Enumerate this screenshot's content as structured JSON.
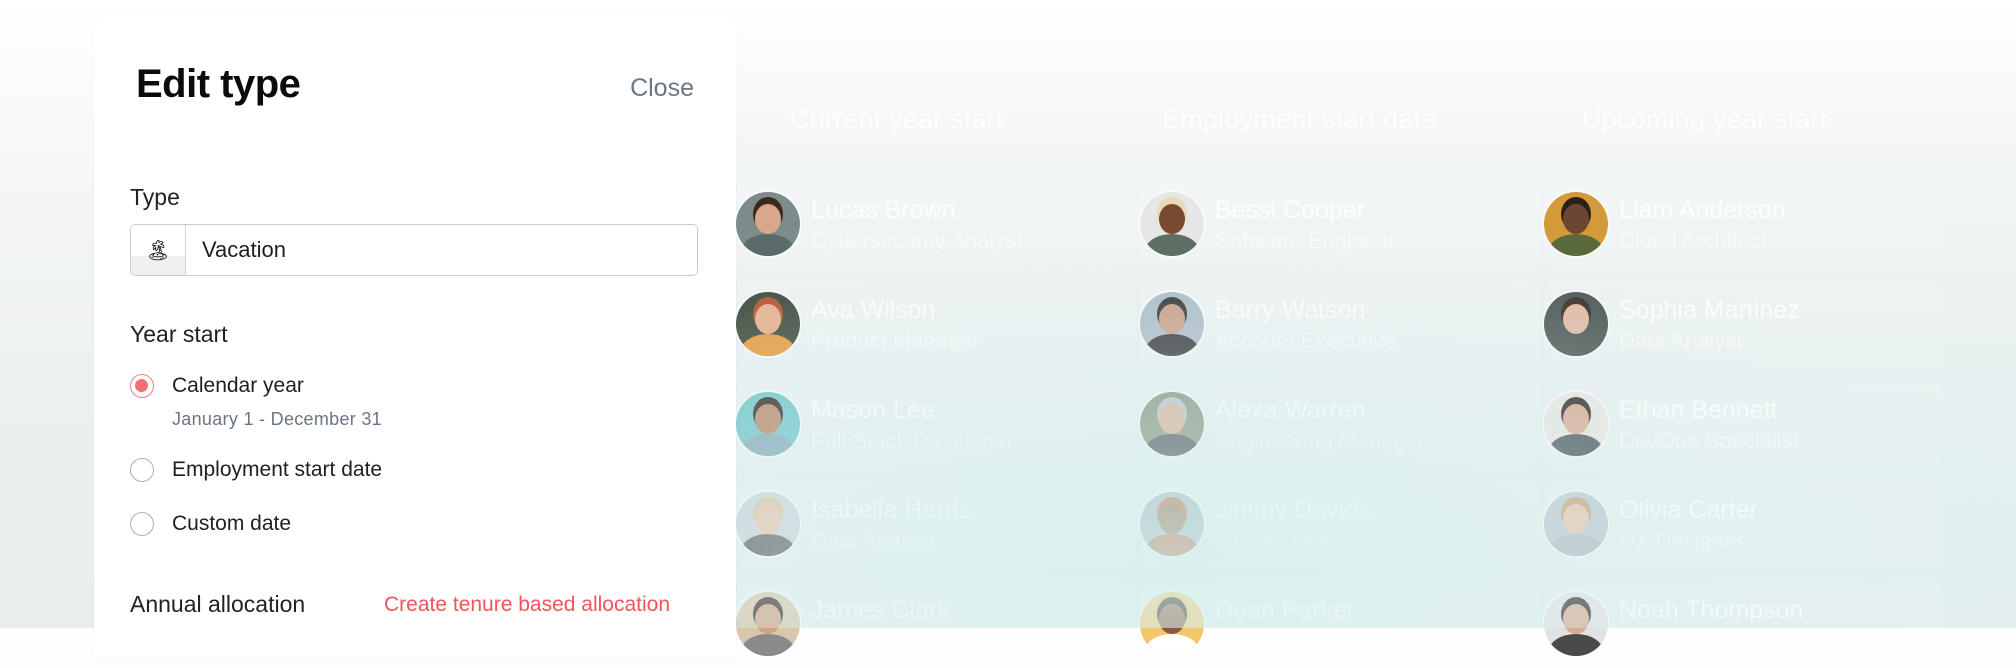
{
  "modal": {
    "title": "Edit type",
    "close_label": "Close",
    "type_label": "Type",
    "type_emoji": "🏝",
    "type_emoji_icon": "desert-island-icon",
    "type_value": "Vacation",
    "year_start_label": "Year start",
    "year_start_options": [
      {
        "label": "Calendar year",
        "sublabel": "January 1 - December 31",
        "checked": true
      },
      {
        "label": "Employment start date",
        "checked": false
      },
      {
        "label": "Custom date",
        "checked": false
      }
    ],
    "annual_allocation_label": "Annual allocation",
    "tenure_link": "Create tenure based allocation"
  },
  "colors": {
    "accent": "#f46d74",
    "link": "#f2545b",
    "muted_text": "#6b7785"
  },
  "board": {
    "columns": [
      {
        "header": "Current year start",
        "people": [
          {
            "name": "Lucas Brown",
            "role": "Cybersecurity Analyst",
            "skin": "#d9a88a",
            "hair": "#3b2a20",
            "bg": "#7d8b8a",
            "shirt": "#5b6a6a"
          },
          {
            "name": "Ava Wilson",
            "role": "Product Manager",
            "skin": "#e4b08e",
            "hair": "#b0552e",
            "bg": "#3f4a3c",
            "shirt": "#e59a3a"
          },
          {
            "name": "Mason Lee",
            "role": "Full Stack Developer",
            "skin": "#b98463",
            "hair": "#2a2220",
            "bg": "#6cc4c8",
            "shirt": "#7fa6b8"
          },
          {
            "name": "Isabella Harris",
            "role": "Data Analyst",
            "skin": "#e6c1a6",
            "hair": "#d9c09a",
            "bg": "#c9d3d8",
            "shirt": "#5a5a5a"
          },
          {
            "name": "James Clark",
            "role": "",
            "skin": "#d2a384",
            "hair": "#3a2a22",
            "bg": "#d8c7ae",
            "shirt": "#8a8a8a"
          }
        ]
      },
      {
        "header": "Employment start date",
        "people": [
          {
            "name": "Bessi Cooper",
            "role": "Software Engineer",
            "skin": "#7a4a30",
            "hair": "#e8d9b8",
            "bg": "#e6e6e6",
            "shirt": "#5d6e62"
          },
          {
            "name": "Barry Watson",
            "role": "Account Executive",
            "skin": "#c79a80",
            "hair": "#2a2a2a",
            "bg": "#a9b8c4",
            "shirt": "#2a2d30"
          },
          {
            "name": "Alexa Warren",
            "role": "Engineering Manager",
            "skin": "#d9a98c",
            "hair": "#b8bcc0",
            "bg": "#7b8a74",
            "shirt": "#3a3f44"
          },
          {
            "name": "Jimmy Davids",
            "role": "Growth Lead",
            "skin": "#8c5a3c",
            "hair": "#b5562e",
            "bg": "#9fb0b8",
            "shirt": "#b0502e"
          },
          {
            "name": "Dean Parker",
            "role": "",
            "skin": "#8a5a3e",
            "hair": "#2a1e18",
            "bg": "#f2c76a",
            "shirt": "#ffffff"
          }
        ]
      },
      {
        "header": "Upcoming year start",
        "people": [
          {
            "name": "Liam Anderson",
            "role": "Cloud Architect",
            "skin": "#6b4632",
            "hair": "#2a2018",
            "bg": "#d49a3a",
            "shirt": "#5a6a3a"
          },
          {
            "name": "Sophia Martinez",
            "role": "Data Analyst",
            "skin": "#e0b9a4",
            "hair": "#3a2a26",
            "bg": "#4a5552",
            "shirt": "#4a5552"
          },
          {
            "name": "Ethan Bennett",
            "role": "DevOps Specialist",
            "skin": "#d6a58a",
            "hair": "#1f1a18",
            "bg": "#e8e4e0",
            "shirt": "#3a4a4e"
          },
          {
            "name": "Olivia Carter",
            "role": "UX Designer",
            "skin": "#e6c0a8",
            "hair": "#c59a6a",
            "bg": "#b8c4cc",
            "shirt": "#aab8bc"
          },
          {
            "name": "Noah Thompson",
            "role": "",
            "skin": "#d8aa90",
            "hair": "#2a2220",
            "bg": "#e2e2e2",
            "shirt": "#4a4a4a"
          }
        ]
      }
    ]
  }
}
